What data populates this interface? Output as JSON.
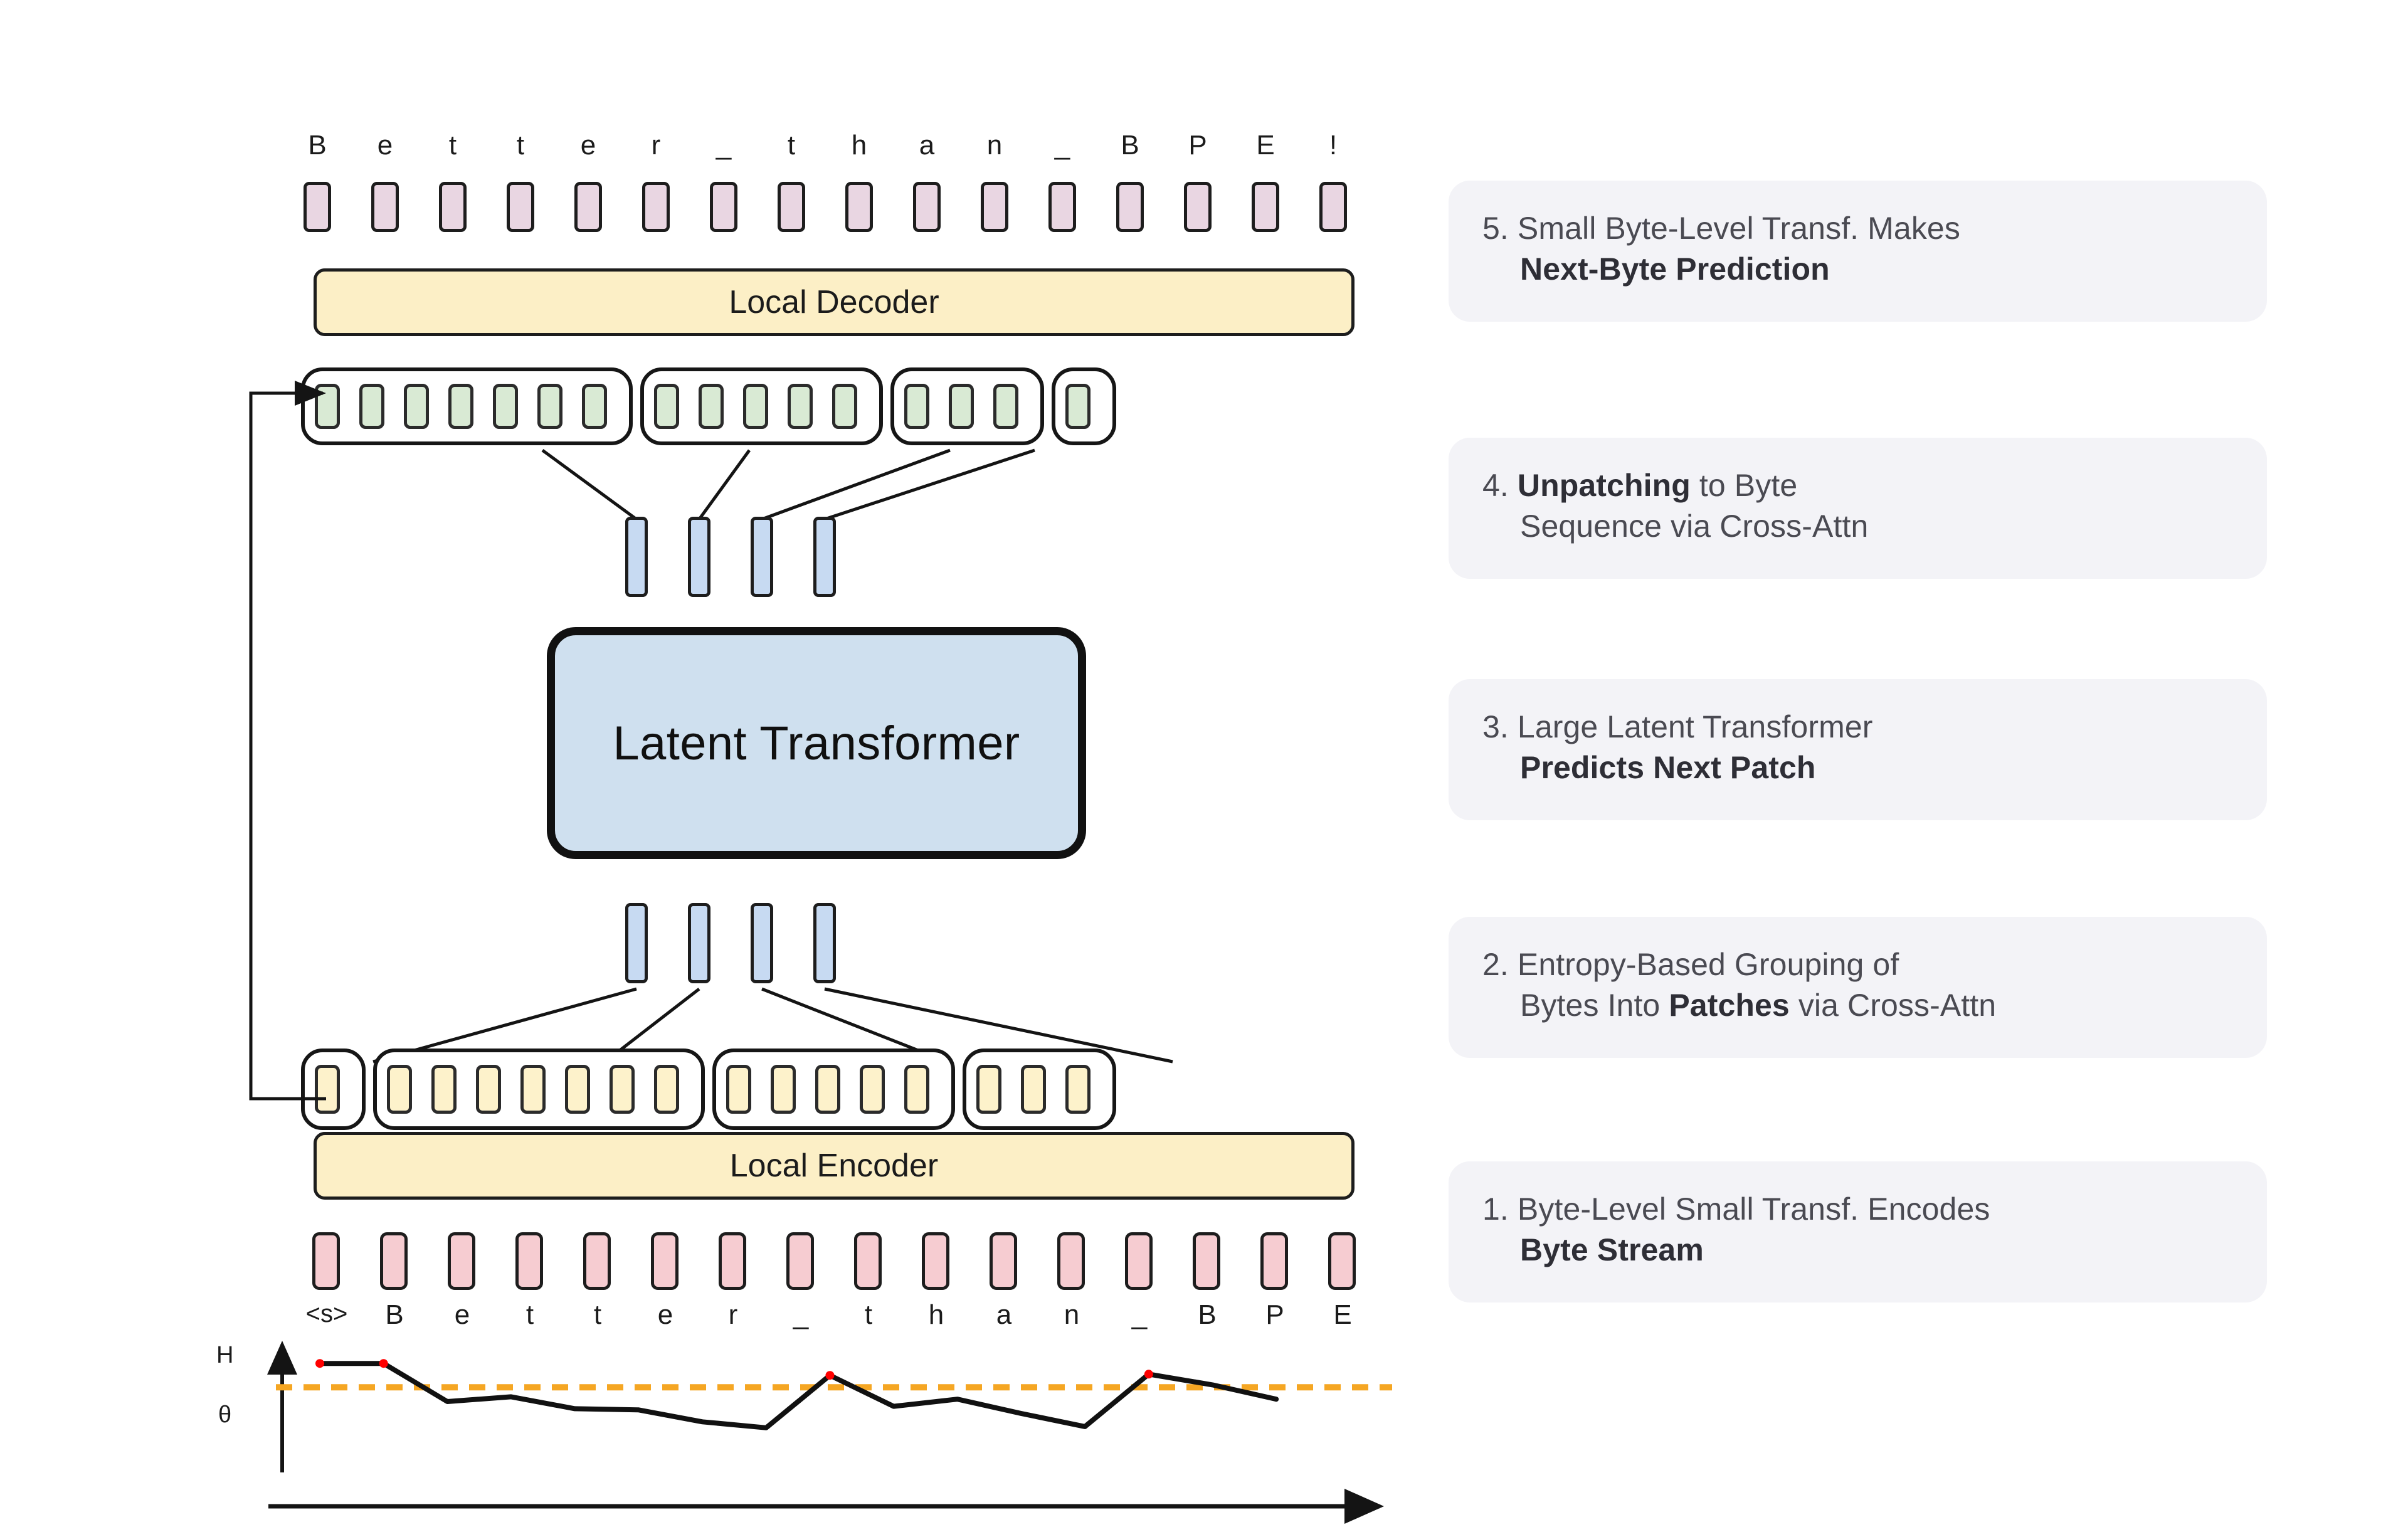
{
  "diagram": {
    "title": "Byte Latent Transformer architecture",
    "top_sequence": {
      "label": "output bytes",
      "letters": [
        "B",
        "e",
        "t",
        "t",
        "e",
        "r",
        "_",
        "t",
        "h",
        "a",
        "n",
        "_",
        "B",
        "P",
        "E",
        "!"
      ]
    },
    "local_decoder": {
      "label": "Local Decoder"
    },
    "patch_groups_top": {
      "label": "decoder byte representations grouped into patches",
      "sizes": [
        7,
        5,
        3,
        1
      ]
    },
    "patch_vectors_top": {
      "label": "patch vectors out of latent transformer",
      "count": 4
    },
    "latent_transformer": {
      "label": "Latent Transformer"
    },
    "patch_vectors_bottom": {
      "label": "patch vectors into latent transformer",
      "count": 4
    },
    "patch_groups_bottom": {
      "label": "encoder byte representations grouped into patches",
      "sizes": [
        1,
        7,
        5,
        3
      ]
    },
    "local_encoder": {
      "label": "Local Encoder"
    },
    "bottom_sequence": {
      "label": "input bytes",
      "letters": [
        "<s>",
        "B",
        "e",
        "t",
        "t",
        "e",
        "r",
        "_",
        "t",
        "h",
        "a",
        "n",
        "_",
        "B",
        "P",
        "E"
      ]
    },
    "feedback_arrow": {
      "label": "residual connection from first encoder byte to first decoder byte"
    }
  },
  "chart_data": {
    "type": "line",
    "title": "",
    "ylabel": "H",
    "xlabel": "",
    "threshold_label": "θ",
    "threshold_value": 0.62,
    "threshold_color": "#f5a623",
    "line_color": "#111111",
    "marker_color": "#ff0000",
    "grid": false,
    "legend": false,
    "ylim": [
      0,
      1
    ],
    "x": [
      1,
      2,
      3,
      4,
      5,
      6,
      7,
      8,
      9,
      10,
      11,
      12,
      13,
      14,
      15,
      16
    ],
    "values": [
      0.82,
      0.82,
      0.5,
      0.54,
      0.44,
      0.43,
      0.33,
      0.28,
      0.72,
      0.46,
      0.52,
      0.4,
      0.29,
      0.73,
      0.64,
      0.52
    ],
    "above_threshold_indices": [
      1,
      2,
      9,
      14
    ],
    "x_tick_labels": [
      "<s>",
      "B",
      "e",
      "t",
      "t",
      "e",
      "r",
      "_",
      "t",
      "h",
      "a",
      "n",
      "_",
      "B",
      "P",
      "E"
    ]
  },
  "steps": [
    {
      "number": "5.",
      "line1_plain": "Small Byte-Level Transf. Makes",
      "line2_bold": "Next-Byte Prediction",
      "line2_plain": ""
    },
    {
      "number": "4.",
      "line1_bold": "Unpatching",
      "line1_plain": " to Byte",
      "line2_plain": "Sequence via Cross-Attn"
    },
    {
      "number": "3.",
      "line1_plain": "Large Latent Transformer",
      "line2_bold": "Predicts Next Patch"
    },
    {
      "number": "2.",
      "line1_plain": "Entropy-Based Grouping of",
      "line2_pre": "Bytes Into ",
      "line2_bold": "Patches",
      "line2_post": " via Cross-Attn"
    },
    {
      "number": "1.",
      "line1_plain": "Byte-Level  Small Transf. Encodes",
      "line2_bold": "Byte Stream"
    }
  ],
  "colors": {
    "byte_top": "#e9d6e2",
    "byte_bottom": "#f6ccd1",
    "local_box": "#fcefc6",
    "latent_box": "#cfe0ef",
    "patch_cell_green": "#d9ead4",
    "patch_cell_yellow": "#fdf2cb",
    "patch_vector": "#c7daf2",
    "card_bg": "#f3f3f7",
    "threshold": "#f5a623",
    "stroke": "#1d1d1d"
  }
}
